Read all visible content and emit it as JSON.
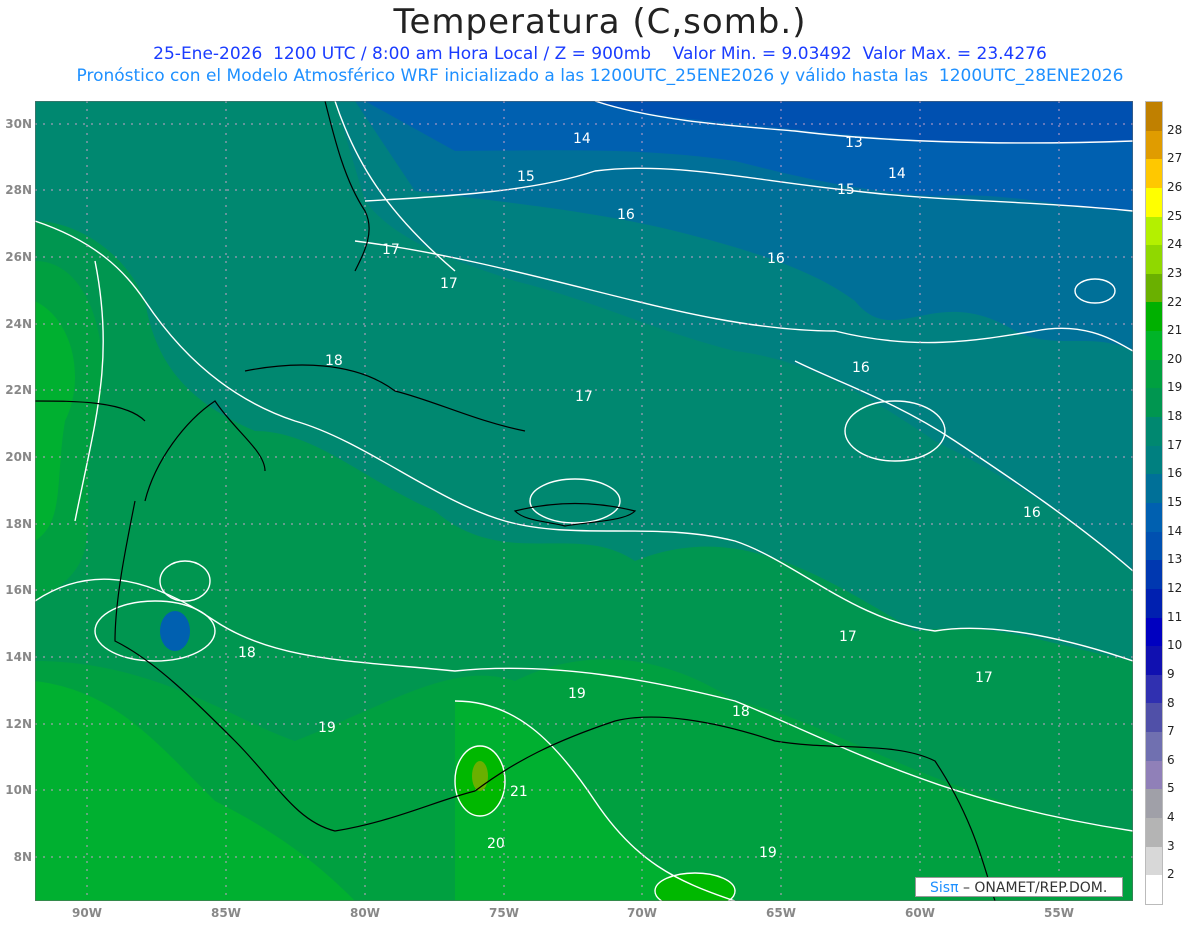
{
  "header": {
    "title": "Temperatura (C,somb.)",
    "line1": "25-Ene-2026  1200 UTC / 8:00 am Hora Local / Z = 900mb    Valor Min. = 9.03492  Valor Max. = 23.4276",
    "line2": "Pronóstico con el Modelo Atmosférico WRF inicializado a las 1200UTC_25ENE2026 y válido hasta las  1200UTC_28ENE2026"
  },
  "map": {
    "lat_labels": [
      "30N",
      "28N",
      "26N",
      "24N",
      "22N",
      "20N",
      "18N",
      "16N",
      "14N",
      "12N",
      "10N",
      "8N"
    ],
    "lon_labels": [
      "90W",
      "85W",
      "80W",
      "75W",
      "70W",
      "65W",
      "60W",
      "55W"
    ],
    "contour_labels": [
      "14",
      "13",
      "14",
      "15",
      "15",
      "16",
      "16",
      "17",
      "17",
      "18",
      "17",
      "16",
      "16",
      "18",
      "19",
      "19",
      "18",
      "17",
      "17",
      "21",
      "20",
      "19"
    ]
  },
  "colorbar": {
    "labels": [
      "28",
      "27",
      "26",
      "25",
      "24",
      "23",
      "22",
      "21",
      "20",
      "19",
      "18",
      "17",
      "16",
      "15",
      "14",
      "13",
      "12",
      "11",
      "10",
      "9",
      "8",
      "7",
      "6",
      "5",
      "4",
      "3",
      "2"
    ],
    "colors": [
      "#c08000",
      "#e09c00",
      "#ffc800",
      "#ffff00",
      "#b4f000",
      "#90d800",
      "#6ab000",
      "#00b000",
      "#00b428",
      "#00a040",
      "#009650",
      "#008870",
      "#008080",
      "#007098",
      "#0060b0",
      "#0050b0",
      "#0038b0",
      "#0020b0",
      "#0000c0",
      "#1010b0",
      "#3030b0",
      "#5050a8",
      "#7070b0",
      "#9080b8",
      "#a0a0a8",
      "#b4b4b4",
      "#d8d8d8",
      "#ffffff"
    ]
  },
  "credit": {
    "brand": "Sisπ",
    "text": " – ONAMET/REP.DOM."
  }
}
